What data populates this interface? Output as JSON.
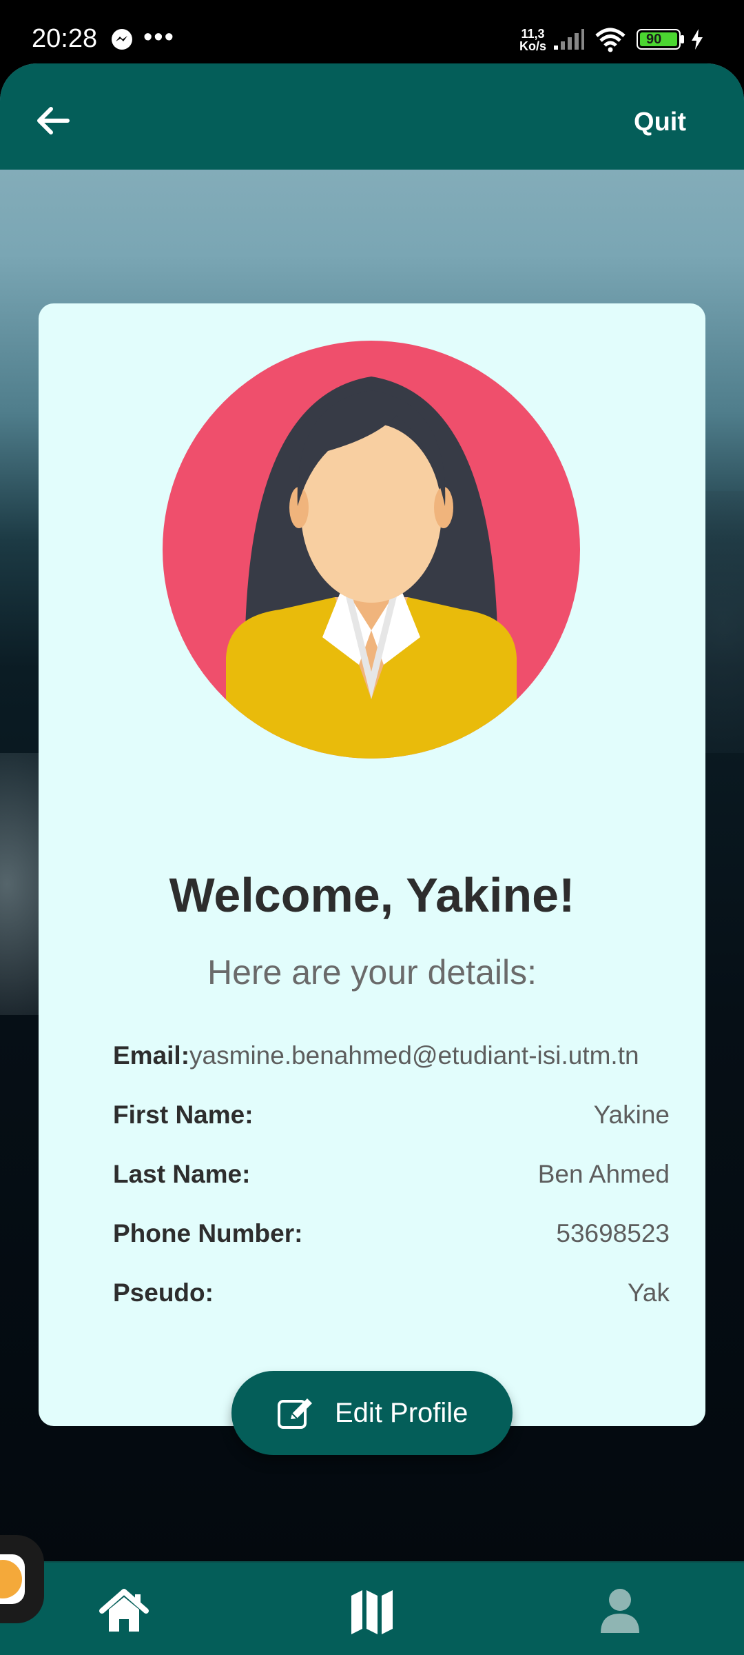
{
  "status_bar": {
    "time": "20:28",
    "dots": "•••",
    "net_speed_top": "11,3",
    "net_speed_bottom": "Ko/s",
    "battery": "90"
  },
  "top_bar": {
    "back_icon": "arrow-left-icon",
    "quit_label": "Quit"
  },
  "profile": {
    "welcome": "Welcome, Yakine!",
    "subtitle": "Here are your details:",
    "details": [
      {
        "label": "Email:",
        "value": "yasmine.benahmed@etudiant-isi.utm.tn"
      },
      {
        "label": "First Name:",
        "value": "Yakine"
      },
      {
        "label": "Last Name:",
        "value": "Ben Ahmed"
      },
      {
        "label": "Phone Number:",
        "value": "53698523"
      },
      {
        "label": "Pseudo:",
        "value": "Yak"
      }
    ],
    "edit_button_label": "Edit Profile"
  },
  "bottom_nav": {
    "items": [
      {
        "icon": "home-icon"
      },
      {
        "icon": "map-icon"
      },
      {
        "icon": "user-icon"
      }
    ]
  },
  "colors": {
    "primary": "#045e59",
    "card_bg": "#e2fdfc",
    "avatar_bg": "#ef4f6c",
    "shirt": "#e9bb0b"
  }
}
